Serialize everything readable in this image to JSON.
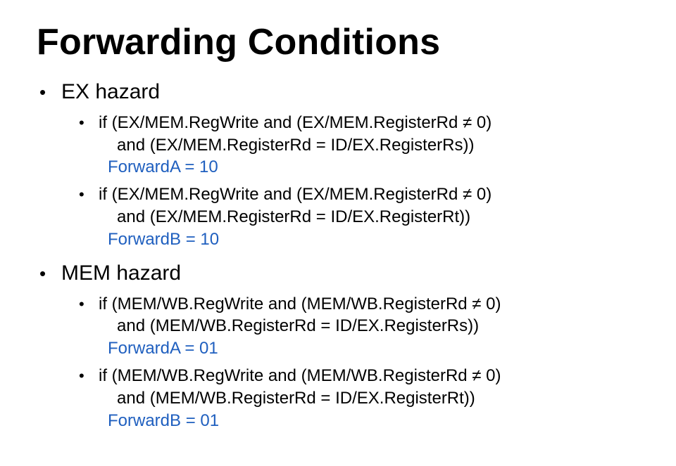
{
  "title": "Forwarding Conditions",
  "accent_color": "#1f5fbf",
  "sections": [
    {
      "heading": "EX hazard",
      "items": [
        {
          "line1": "if (EX/MEM.RegWrite and (EX/MEM.RegisterRd ≠ 0)",
          "line2": "and (EX/MEM.RegisterRd = ID/EX.RegisterRs))",
          "result": "ForwardA = 10"
        },
        {
          "line1": "if (EX/MEM.RegWrite and (EX/MEM.RegisterRd ≠ 0)",
          "line2": "and (EX/MEM.RegisterRd = ID/EX.RegisterRt))",
          "result": "ForwardB = 10"
        }
      ]
    },
    {
      "heading": "MEM hazard",
      "items": [
        {
          "line1": "if (MEM/WB.RegWrite and (MEM/WB.RegisterRd ≠ 0)",
          "line2": "and (MEM/WB.RegisterRd = ID/EX.RegisterRs))",
          "result": "ForwardA = 01"
        },
        {
          "line1": "if (MEM/WB.RegWrite and (MEM/WB.RegisterRd ≠ 0)",
          "line2": "and (MEM/WB.RegisterRd = ID/EX.RegisterRt))",
          "result": "ForwardB = 01"
        }
      ]
    }
  ]
}
